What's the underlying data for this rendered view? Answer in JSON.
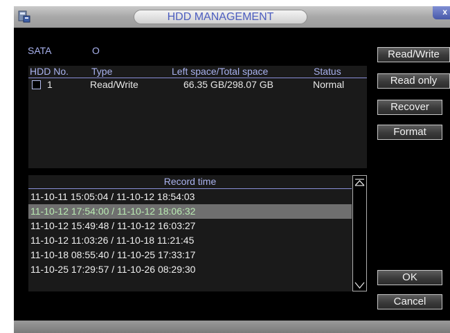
{
  "window": {
    "title": "HDD MANAGEMENT",
    "close_label": "x"
  },
  "sata": {
    "label": "SATA",
    "value": "O"
  },
  "hdd_table": {
    "headers": [
      "HDD No.",
      "Type",
      "Left space/Total space",
      "Status"
    ],
    "rows": [
      {
        "number": "1",
        "type": "Read/Write",
        "space": "66.35 GB/298.07 GB",
        "status": "Normal"
      }
    ]
  },
  "record_time": {
    "header": "Record time",
    "rows": [
      "11-10-11 15:05:04 / 11-10-12 18:54:03",
      "11-10-12 17:54:00 / 11-10-12 18:06:32",
      "11-10-12 15:49:48 / 11-10-12 16:03:27",
      "11-10-12 11:03:26 / 11-10-18 11:21:45",
      "11-10-18 08:55:40 / 11-10-25 17:33:17",
      "11-10-25 17:29:57 / 11-10-26 08:29:30"
    ],
    "selected_index": 1
  },
  "buttons": {
    "read_write": "Read/Write",
    "read_only": "Read only",
    "recover": "Recover",
    "format": "Format",
    "ok": "OK",
    "cancel": "Cancel"
  },
  "icons": {
    "app": "hdd-app-icon",
    "scroll_up": "scroll-up-icon",
    "scroll_down": "scroll-down-icon"
  },
  "colors": {
    "label": "#a9b2ee",
    "selected_row_bg": "#6f6f6f",
    "selected_row_text": "#b9eab2"
  }
}
